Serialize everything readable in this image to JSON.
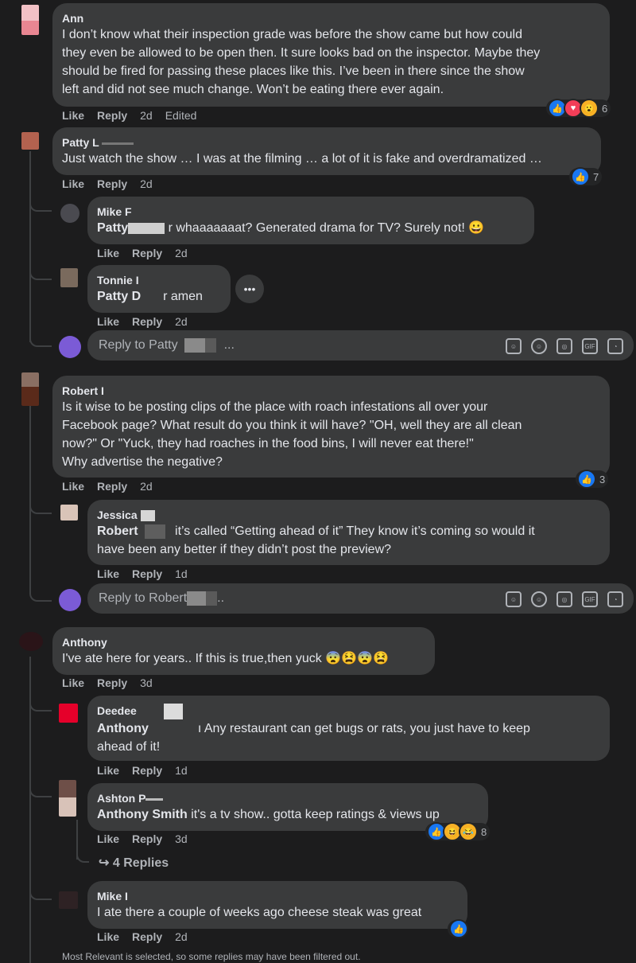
{
  "actions": {
    "like": "Like",
    "reply": "Reply"
  },
  "comments": [
    {
      "name": "Ann",
      "text": "I don’t know what their inspection grade was before the show came but how could\nthey even be allowed to be open then. It sure looks bad on the inspector. Maybe they\nshould be fired for passing these places like this. I’ve been in there since the show\nleft and did not see much change. Won’t be eating there ever again.",
      "time": "2d",
      "edited": "Edited",
      "reactions": "6"
    },
    {
      "name": "Patty L",
      "text": "Just watch the show … I was at the filming … a lot of it is fake and overdramatized …",
      "time": "2d",
      "reactions": "7"
    },
    {
      "name": "Mike F",
      "mention": "Patty",
      "text": "r whaaaaaaat? Generated drama for TV? Surely not! 😀",
      "time": "2d"
    },
    {
      "name": "Tonnie I",
      "mention": "Patty D",
      "text": "r amen",
      "time": "2d"
    },
    {
      "name": "Robert I",
      "text": "Is it wise to be posting clips of the place with roach infestations all over your\nFacebook page? What result do you think it will have? \"OH, well they are all clean\nnow?\" Or \"Yuck, they had roaches in the food bins, I will never eat there!\"\nWhy advertise the negative?",
      "time": "2d",
      "reactions": "3"
    },
    {
      "name": "Jessica",
      "mention": "Robert",
      "text": "it’s called “Getting ahead of it” They know it’s coming so would it",
      "text2": "have been any better if they didn’t post the preview?",
      "time": "1d"
    },
    {
      "name": "Anthony",
      "text": "I've ate here for years.. If this is true,then yuck 😨😫😨😫",
      "time": "3d"
    },
    {
      "name": "Deedee",
      "mention": "Anthony",
      "text": "ı Any restaurant can get bugs or rats, you just have to keep",
      "text2": "ahead of it!",
      "time": "1d"
    },
    {
      "name": "Ashton P",
      "mention": "Anthony Smith",
      "text": "it's a tv show.. gotta keep ratings & views up",
      "time": "3d",
      "reactions": "8"
    },
    {
      "name": "Mike I",
      "text": "I ate there a couple of weeks ago cheese steak was great",
      "time": "2d"
    }
  ],
  "reply_boxes": [
    {
      "placeholder": "Reply to Patty",
      "suffix": "..."
    },
    {
      "placeholder": "Reply to Robert",
      "suffix": ".."
    }
  ],
  "more_replies": "4 Replies",
  "footer": "Most Relevant is selected, so some replies may have been filtered out.",
  "icons": {
    "more": "more-options-icon",
    "sticker": "sticker-icon",
    "emoji": "emoji-icon",
    "camera": "camera-icon",
    "gif": "gif-icon",
    "avatar": "avatar-sticker-icon"
  }
}
